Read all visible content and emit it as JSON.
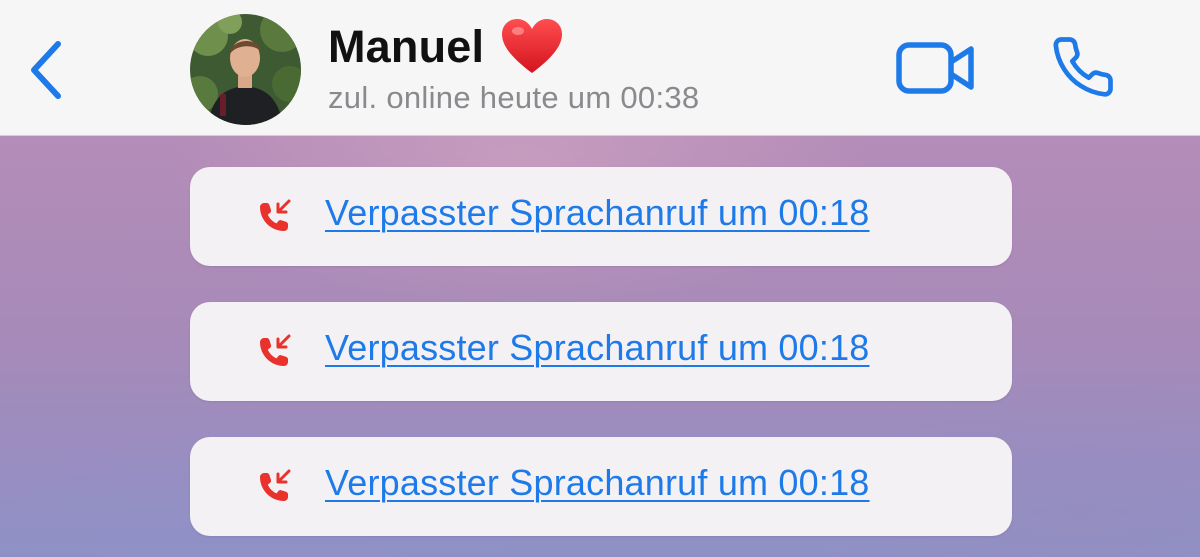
{
  "header": {
    "back_icon": "chevron-left-icon",
    "contact_name": "Manuel",
    "contact_emoji": "heart-icon",
    "status": "zul. online heute um 00:38",
    "video_icon": "video-camera-icon",
    "call_icon": "phone-icon"
  },
  "messages": [
    {
      "type": "missed-voice-call",
      "icon": "missed-call-icon",
      "text": "Verpasster Sprachanruf um 00:18"
    },
    {
      "type": "missed-voice-call",
      "icon": "missed-call-icon",
      "text": "Verpasster Sprachanruf um 00:18"
    },
    {
      "type": "missed-voice-call",
      "icon": "missed-call-icon",
      "text": "Verpasster Sprachanruf um 00:18"
    }
  ],
  "colors": {
    "accent": "#1d7ae8",
    "missed_call": "#e8322b",
    "heart": "#e8232f",
    "header_bg": "#f6f6f7",
    "status_text": "#8a8a8e"
  }
}
